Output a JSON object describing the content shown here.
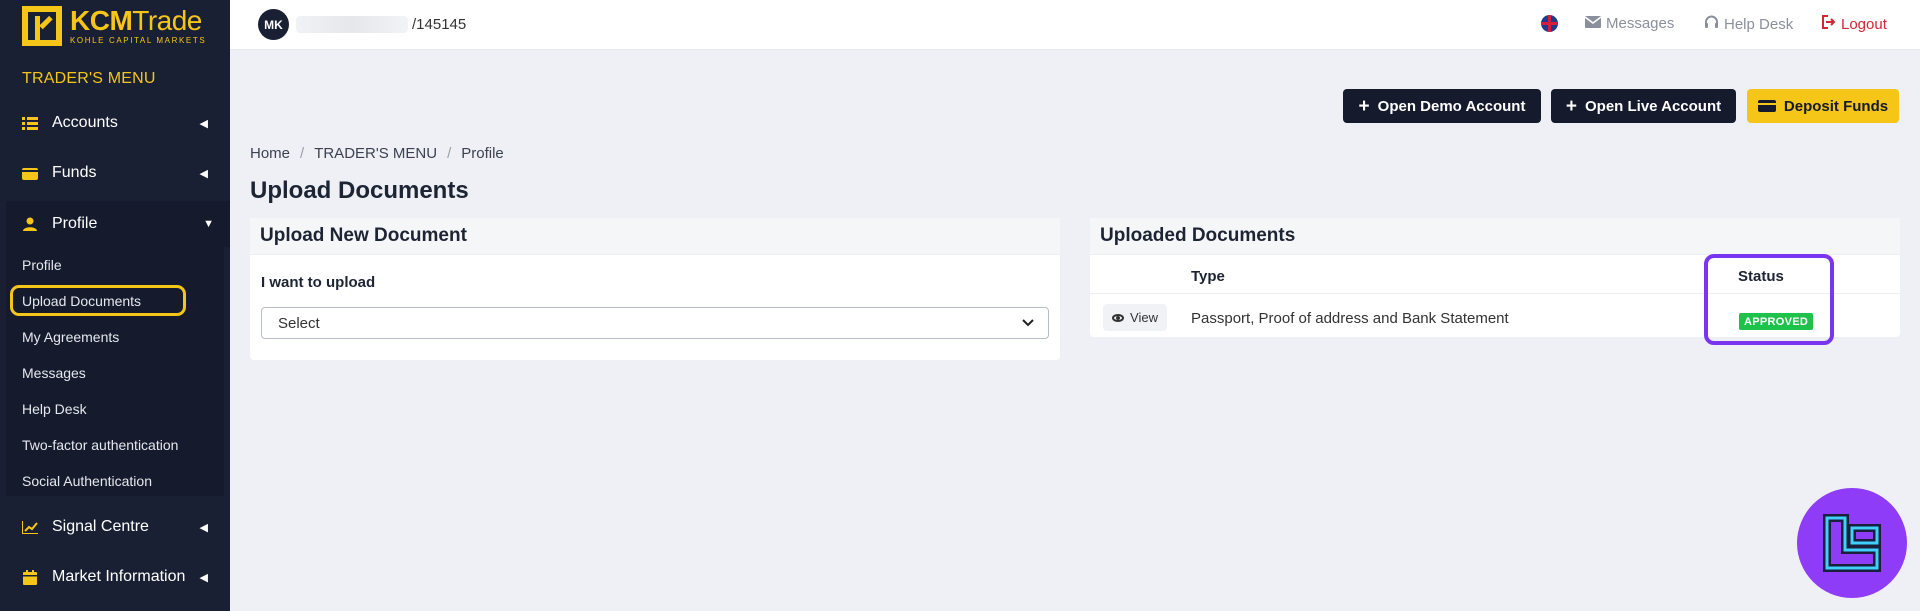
{
  "brand": {
    "name_bold": "KCM",
    "name_rest": "Trade",
    "tagline": "KOHLE CAPITAL MARKETS"
  },
  "sidebar": {
    "section_title": "TRADER'S MENU",
    "items": [
      {
        "label": "Accounts",
        "icon": "list-icon"
      },
      {
        "label": "Funds",
        "icon": "wallet-icon"
      },
      {
        "label": "Profile",
        "icon": "user-icon",
        "expanded": true
      },
      {
        "label": "Signal Centre",
        "icon": "chart-icon"
      },
      {
        "label": "Market Information",
        "icon": "calendar-icon"
      }
    ],
    "profile_submenu": [
      {
        "label": "Profile"
      },
      {
        "label": "Upload Documents",
        "active": true
      },
      {
        "label": "My Agreements"
      },
      {
        "label": "Messages"
      },
      {
        "label": "Help Desk"
      },
      {
        "label": "Two-factor authentication"
      },
      {
        "label": "Social Authentication"
      }
    ]
  },
  "topbar": {
    "avatar_initials": "MK",
    "account_id": "/145145",
    "messages_label": "Messages",
    "helpdesk_label": "Help Desk",
    "logout_label": "Logout"
  },
  "actions": {
    "open_demo": "Open Demo Account",
    "open_live": "Open Live Account",
    "deposit": "Deposit Funds"
  },
  "breadcrumb": [
    "Home",
    "TRADER'S MENU",
    "Profile"
  ],
  "page_title": "Upload Documents",
  "upload_panel": {
    "title": "Upload New Document",
    "field_label": "I want to upload",
    "select_value": "Select"
  },
  "uploaded_panel": {
    "title": "Uploaded Documents",
    "columns": [
      "Type",
      "Status"
    ],
    "rows": [
      {
        "action": "View",
        "type": "Passport, Proof of address and Bank Statement",
        "status": "APPROVED"
      }
    ]
  },
  "colors": {
    "sidebar_bg": "#1a2034",
    "accent": "#f5c518",
    "approved": "#1ec24a",
    "highlight": "#7a35f0",
    "logout": "#d22633"
  }
}
